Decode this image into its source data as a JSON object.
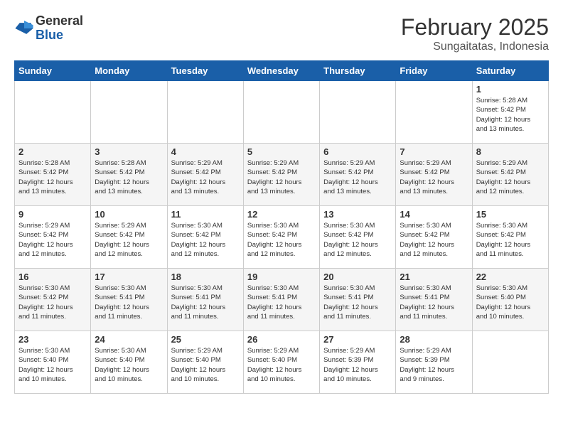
{
  "header": {
    "logo_general": "General",
    "logo_blue": "Blue",
    "month": "February 2025",
    "location": "Sungaitatas, Indonesia"
  },
  "weekdays": [
    "Sunday",
    "Monday",
    "Tuesday",
    "Wednesday",
    "Thursday",
    "Friday",
    "Saturday"
  ],
  "weeks": [
    [
      {
        "day": "",
        "info": ""
      },
      {
        "day": "",
        "info": ""
      },
      {
        "day": "",
        "info": ""
      },
      {
        "day": "",
        "info": ""
      },
      {
        "day": "",
        "info": ""
      },
      {
        "day": "",
        "info": ""
      },
      {
        "day": "1",
        "info": "Sunrise: 5:28 AM\nSunset: 5:42 PM\nDaylight: 12 hours\nand 13 minutes."
      }
    ],
    [
      {
        "day": "2",
        "info": "Sunrise: 5:28 AM\nSunset: 5:42 PM\nDaylight: 12 hours\nand 13 minutes."
      },
      {
        "day": "3",
        "info": "Sunrise: 5:28 AM\nSunset: 5:42 PM\nDaylight: 12 hours\nand 13 minutes."
      },
      {
        "day": "4",
        "info": "Sunrise: 5:29 AM\nSunset: 5:42 PM\nDaylight: 12 hours\nand 13 minutes."
      },
      {
        "day": "5",
        "info": "Sunrise: 5:29 AM\nSunset: 5:42 PM\nDaylight: 12 hours\nand 13 minutes."
      },
      {
        "day": "6",
        "info": "Sunrise: 5:29 AM\nSunset: 5:42 PM\nDaylight: 12 hours\nand 13 minutes."
      },
      {
        "day": "7",
        "info": "Sunrise: 5:29 AM\nSunset: 5:42 PM\nDaylight: 12 hours\nand 13 minutes."
      },
      {
        "day": "8",
        "info": "Sunrise: 5:29 AM\nSunset: 5:42 PM\nDaylight: 12 hours\nand 12 minutes."
      }
    ],
    [
      {
        "day": "9",
        "info": "Sunrise: 5:29 AM\nSunset: 5:42 PM\nDaylight: 12 hours\nand 12 minutes."
      },
      {
        "day": "10",
        "info": "Sunrise: 5:29 AM\nSunset: 5:42 PM\nDaylight: 12 hours\nand 12 minutes."
      },
      {
        "day": "11",
        "info": "Sunrise: 5:30 AM\nSunset: 5:42 PM\nDaylight: 12 hours\nand 12 minutes."
      },
      {
        "day": "12",
        "info": "Sunrise: 5:30 AM\nSunset: 5:42 PM\nDaylight: 12 hours\nand 12 minutes."
      },
      {
        "day": "13",
        "info": "Sunrise: 5:30 AM\nSunset: 5:42 PM\nDaylight: 12 hours\nand 12 minutes."
      },
      {
        "day": "14",
        "info": "Sunrise: 5:30 AM\nSunset: 5:42 PM\nDaylight: 12 hours\nand 12 minutes."
      },
      {
        "day": "15",
        "info": "Sunrise: 5:30 AM\nSunset: 5:42 PM\nDaylight: 12 hours\nand 11 minutes."
      }
    ],
    [
      {
        "day": "16",
        "info": "Sunrise: 5:30 AM\nSunset: 5:42 PM\nDaylight: 12 hours\nand 11 minutes."
      },
      {
        "day": "17",
        "info": "Sunrise: 5:30 AM\nSunset: 5:41 PM\nDaylight: 12 hours\nand 11 minutes."
      },
      {
        "day": "18",
        "info": "Sunrise: 5:30 AM\nSunset: 5:41 PM\nDaylight: 12 hours\nand 11 minutes."
      },
      {
        "day": "19",
        "info": "Sunrise: 5:30 AM\nSunset: 5:41 PM\nDaylight: 12 hours\nand 11 minutes."
      },
      {
        "day": "20",
        "info": "Sunrise: 5:30 AM\nSunset: 5:41 PM\nDaylight: 12 hours\nand 11 minutes."
      },
      {
        "day": "21",
        "info": "Sunrise: 5:30 AM\nSunset: 5:41 PM\nDaylight: 12 hours\nand 11 minutes."
      },
      {
        "day": "22",
        "info": "Sunrise: 5:30 AM\nSunset: 5:40 PM\nDaylight: 12 hours\nand 10 minutes."
      }
    ],
    [
      {
        "day": "23",
        "info": "Sunrise: 5:30 AM\nSunset: 5:40 PM\nDaylight: 12 hours\nand 10 minutes."
      },
      {
        "day": "24",
        "info": "Sunrise: 5:30 AM\nSunset: 5:40 PM\nDaylight: 12 hours\nand 10 minutes."
      },
      {
        "day": "25",
        "info": "Sunrise: 5:29 AM\nSunset: 5:40 PM\nDaylight: 12 hours\nand 10 minutes."
      },
      {
        "day": "26",
        "info": "Sunrise: 5:29 AM\nSunset: 5:40 PM\nDaylight: 12 hours\nand 10 minutes."
      },
      {
        "day": "27",
        "info": "Sunrise: 5:29 AM\nSunset: 5:39 PM\nDaylight: 12 hours\nand 10 minutes."
      },
      {
        "day": "28",
        "info": "Sunrise: 5:29 AM\nSunset: 5:39 PM\nDaylight: 12 hours\nand 9 minutes."
      },
      {
        "day": "",
        "info": ""
      }
    ]
  ]
}
